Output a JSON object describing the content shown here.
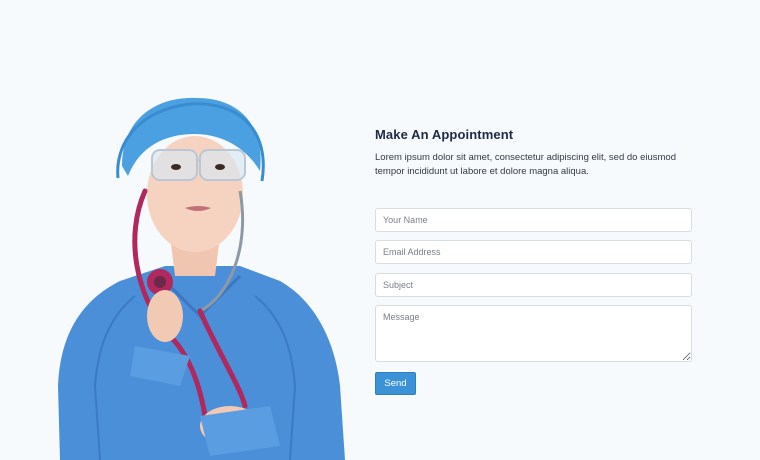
{
  "appointment": {
    "title": "Make An Appointment",
    "description": "Lorem ipsum dolor sit amet, consectetur adipiscing elit, sed do eiusmod tempor incididunt ut labore et dolore magna aliqua.",
    "fields": {
      "name_placeholder": "Your Name",
      "email_placeholder": "Email Address",
      "subject_placeholder": "Subject",
      "message_placeholder": "Message"
    },
    "send_label": "Send"
  },
  "colors": {
    "background": "#f6fafc",
    "heading": "#1d2a44",
    "button": "#3c92d6",
    "scrubs": "#4a90d9",
    "stethoscope": "#b0285c"
  }
}
